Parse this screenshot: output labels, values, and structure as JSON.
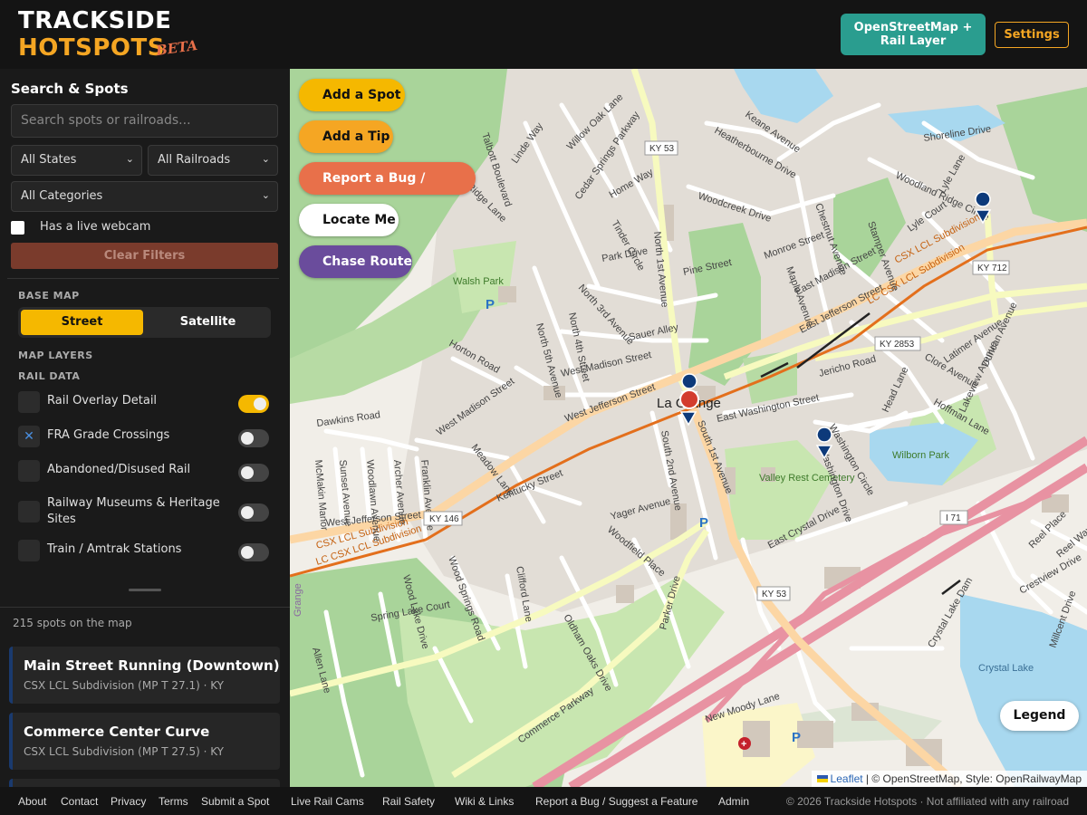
{
  "header": {
    "logo_line1": "TRACKSIDE",
    "logo_line2": "HOTSPOTS",
    "beta": "BETA",
    "layer_button": "OpenStreetMap + Rail Layer",
    "settings_button": "Settings"
  },
  "sidebar": {
    "title": "Search & Spots",
    "search_placeholder": "Search spots or railroads...",
    "state_select": "All States",
    "railroad_select": "All Railroads",
    "category_select": "All Categories",
    "webcam_label": "Has a live webcam",
    "clear_filters": "Clear Filters",
    "base_map_label": "BASE MAP",
    "base_map_options": [
      "Street",
      "Satellite"
    ],
    "map_layers_label": "MAP LAYERS",
    "rail_data_label": "RAIL DATA",
    "layers": [
      {
        "label": "Rail Overlay Detail",
        "checked": false,
        "on": true
      },
      {
        "label": "FRA Grade Crossings",
        "checked": true,
        "on": false
      },
      {
        "label": "Abandoned/Disused Rail",
        "checked": false,
        "on": false
      },
      {
        "label": "Railway Museums & Heritage Sites",
        "checked": false,
        "on": false
      },
      {
        "label": "Train / Amtrak Stations",
        "checked": false,
        "on": false
      }
    ],
    "spot_count": "215 spots on the map",
    "spots": [
      {
        "title": "Main Street Running (Downtown)",
        "subtitle": "CSX LCL Subdivision (MP T 27.1) · KY"
      },
      {
        "title": "Commerce Center Curve",
        "subtitle": "CSX LCL Subdivision (MP T 27.5) · KY"
      }
    ]
  },
  "map": {
    "buttons": {
      "add_spot": "Add a Spot",
      "add_tip": "Add a Tip",
      "report_bug": "Report a Bug / Feature",
      "locate_me": "Locate Me",
      "chase_route": "Chase Route"
    },
    "legend": "Legend",
    "attribution_leaflet": "Leaflet",
    "attribution_text": "| © OpenStreetMap, Style: OpenRailwayMap",
    "labels": {
      "ky53_top": "KY 53",
      "ky53_bottom": "KY 53",
      "ky712": "KY 712",
      "ky2853": "KY 2853",
      "ky146": "KY 146",
      "i71": "I 71",
      "town": "La Grange",
      "east_jefferson": "East Jefferson Street",
      "west_jefferson": "West Jefferson Street",
      "west_jefferson2": "West Jefferson Street",
      "south1st": "South 1st Avenue",
      "north1st": "North 1st Avenue",
      "csx1": "LC CSX LCL Subdivision",
      "csx2": "CSX LCL Subdivision",
      "csx3": "LC CSX LCL Subdivision",
      "csx4": "CSX LCL Subdivision",
      "valley_rest": "Valley Rest Cemetery",
      "wilborn": "Wilborn Park",
      "walsh": "Walsh Park",
      "crystal_lake": "Crystal Lake",
      "commerce": "Commerce Parkway",
      "keane": "Keane Avenue",
      "heatherbourne": "Heatherbourne Drive",
      "woodcreek": "Woodcreek Drive",
      "monroe": "Monroe Street",
      "chestnut": "Chestnut Avenue",
      "east_madison": "East Madison Street",
      "maple": "Maple Avenue",
      "jericho": "Jericho Road",
      "east_washington": "East Washington Street",
      "west_madison": "West Madison Street",
      "west_madison2": "West Madison Street",
      "dawkins": "Dawkins Road",
      "horton": "Horton Road",
      "kentucky": "Kentucky Street",
      "meadow": "Meadow Lane",
      "yager": "Yager Avenue",
      "east_crystal": "East Crystal Drive",
      "new_moody": "New Moody Lane",
      "allen": "Allen Lane",
      "wood_springs": "Wood Springs Road",
      "oldham_oaks": "Oldham Oaks Drive",
      "clifford": "Clifford Lane",
      "pine": "Pine Street",
      "north5th": "North 5th Avenue",
      "north4th": "North 4th Street",
      "north3rd": "North 3rd Avenue",
      "sauer": "Sauer Alley",
      "park_dr": "Park Drive",
      "tinder": "Tinder Circle",
      "home_way": "Home Way",
      "cedar": "Cedar Springs Parkway",
      "willow": "Willow Oak Lane",
      "linde": "Linde Way",
      "talbott": "Talbott Boulevard",
      "ridge": "Ridge Lane",
      "shoreline": "Shoreline Drive",
      "woodland": "Woodland Ridge Circle",
      "lyle": "Lyle Court",
      "lyle2": "Lyle Lane",
      "stamper": "Stamper Avenue",
      "latimer": "Latimer Avenue",
      "duncan": "Duncan Avenue",
      "clore": "Clore Avenue",
      "lakeview": "Lakeview Avenue",
      "hoffman": "Hoffman Lane",
      "head": "Head Lane",
      "washington_circle": "Washington Circle",
      "mcmakin": "McMakin Manor",
      "sunset": "Sunset Avenue",
      "woodlawn": "Woodlawn Avenue",
      "archer": "Archer Avenue",
      "franklin": "Franklin Avenue",
      "washington_dr": "Washington Drive",
      "south2nd": "South 2nd Avenue",
      "parker": "Parker Drive",
      "wood_lake": "Wood Lake Drive",
      "woodfield": "Woodfield Place",
      "spring": "Spring Lake Court",
      "crystal_lake_dam": "Crystal Lake Dam",
      "grange": "Grange",
      "reel_place": "Reel Place",
      "reel_way": "Reel Way Drive",
      "crestview": "Crestview Drive",
      "millcent": "Millcent Drive"
    },
    "colors": {
      "background": "#f1eee8",
      "park": "#c8e6b0",
      "wood": "#a9d49a",
      "water": "#a8d8ef",
      "interstate": "#e892a2",
      "primary": "#fcd6a4",
      "secondary": "#f7fabf",
      "rail": "#e36f1c",
      "marker": "#0d3a7a",
      "marker_red": "#d33c2e"
    }
  },
  "footer": {
    "links": [
      "About",
      "Contact",
      "Privacy",
      "Terms",
      "Submit a Spot",
      "Live Rail Cams",
      "Rail Safety",
      "Wiki & Links",
      "Report a Bug / Suggest a Feature",
      "Admin"
    ],
    "copyright": "© 2026 Trackside Hotspots · Not affiliated with any railroad"
  }
}
